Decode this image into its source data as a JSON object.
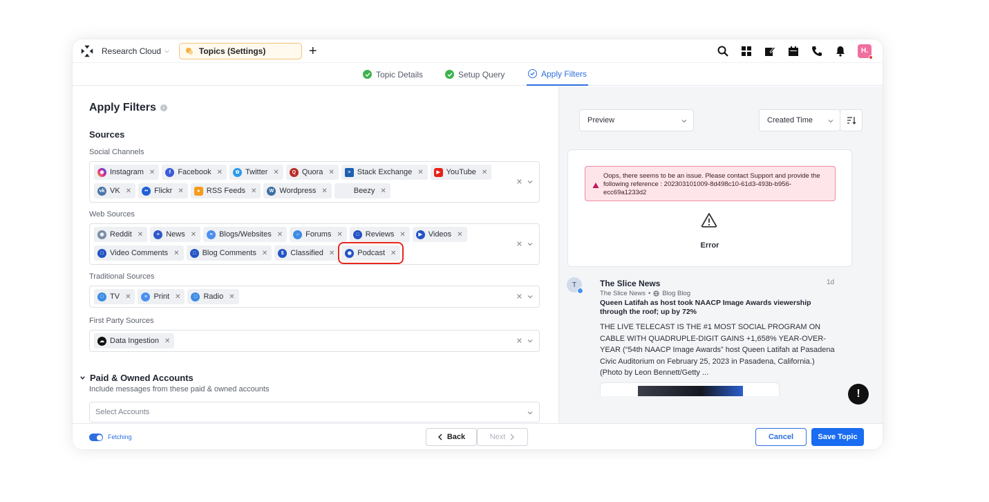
{
  "topbar": {
    "app_name": "Research Cloud",
    "tab_label": "Topics (Settings)",
    "avatar_initial": "H."
  },
  "steps": [
    {
      "label": "Topic Details",
      "state": "done"
    },
    {
      "label": "Setup Query",
      "state": "done"
    },
    {
      "label": "Apply Filters",
      "state": "active"
    }
  ],
  "left": {
    "title": "Apply Filters",
    "sources_title": "Sources",
    "social": {
      "label": "Social Channels",
      "chips": [
        "Instagram",
        "Facebook",
        "Twitter",
        "Quora",
        "Stack Exchange",
        "YouTube",
        "VK",
        "Flickr",
        "RSS Feeds",
        "Wordpress",
        "Beezy"
      ]
    },
    "web": {
      "label": "Web Sources",
      "chips": [
        "Reddit",
        "News",
        "Blogs/Websites",
        "Forums",
        "Reviews",
        "Videos",
        "Video Comments",
        "Blog Comments",
        "Classified",
        "Podcast"
      ]
    },
    "traditional": {
      "label": "Traditional Sources",
      "chips": [
        "TV",
        "Print",
        "Radio"
      ]
    },
    "first_party": {
      "label": "First Party Sources",
      "chips": [
        "Data Ingestion"
      ]
    },
    "paid": {
      "title": "Paid & Owned Accounts",
      "subtitle": "Include messages from these paid & owned accounts",
      "placeholder": "Select Accounts"
    }
  },
  "footer": {
    "fetching": "Fetching",
    "back": "Back",
    "next": "Next",
    "cancel": "Cancel",
    "save": "Save Topic"
  },
  "right": {
    "preview_select": "Preview",
    "sort_select": "Created Time",
    "error_message": "Oops, there seems to be an issue. Please contact Support and provide the following reference : 202303101009-8d498c10-61d3-493b-b956-ecc69a1233d2",
    "error_label": "Error",
    "post": {
      "avatar": "T",
      "title": "The Slice News",
      "time": "1d",
      "source": "The Slice News",
      "channel": "Blog Blog",
      "headline": "Queen Latifah as host took NAACP Image Awards viewership through the roof; up by 72%",
      "body": "THE LIVE TELECAST IS THE #1 MOST SOCIAL PROGRAM ON CABLE WITH QUADRUPLE-DIGIT GAINS +1,658% YEAR-OVER-YEAR        (“54th NAACP Image Awards” host Queen Latifah at Pasadena Civic Auditorium on February 25, 2023 in Pasadena, California.) (Photo by Leon Bennett/Getty ..."
    },
    "fab": "!"
  },
  "colors": {
    "accent": "#1a6cf0",
    "success": "#3cb34a",
    "error_bg": "#fde5ea",
    "highlight": "#e8271e"
  }
}
